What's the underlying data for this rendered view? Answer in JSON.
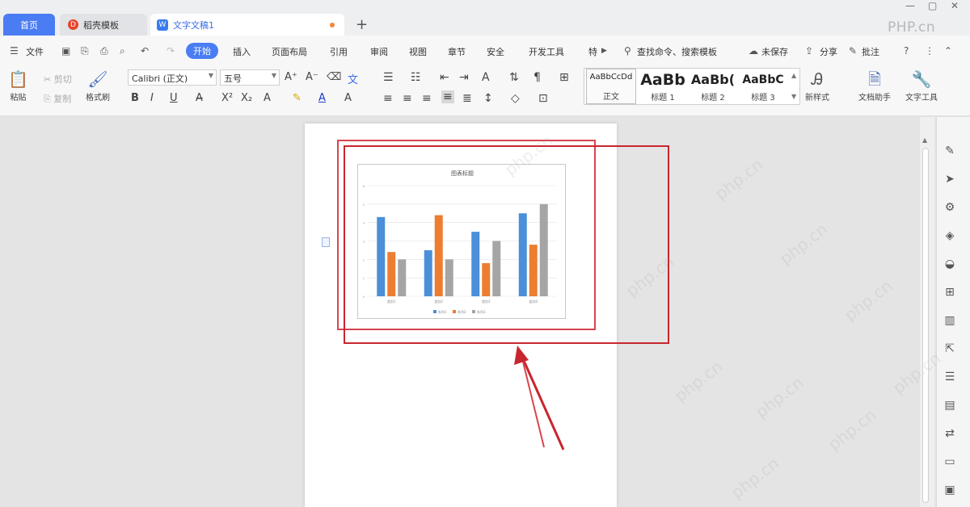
{
  "tabs": {
    "home": "首页",
    "template": "稻壳模板",
    "doc": "文字文稿1",
    "add": "+"
  },
  "brand": "PHP.cn",
  "menu": {
    "file": "文件",
    "items": [
      "开始",
      "插入",
      "页面布局",
      "引用",
      "审阅",
      "视图",
      "章节",
      "安全",
      "开发工具",
      "特"
    ],
    "search": "查找命令、搜索模板",
    "unsaved": "未保存",
    "share": "分享",
    "comment": "批注"
  },
  "ribbon": {
    "paste": "粘贴",
    "cut": "剪切",
    "copy": "复制",
    "format_painter": "格式刷",
    "font_name": "Calibri (正文)",
    "font_size": "五号",
    "styles": [
      {
        "sample": "AaBbCcDd",
        "label": "正文"
      },
      {
        "sample": "AaBb",
        "label": "标题 1"
      },
      {
        "sample": "AaBb(",
        "label": "标题 2"
      },
      {
        "sample": "AaBbC",
        "label": "标题 3"
      }
    ],
    "new_style": "新样式",
    "doc_assistant": "文档助手",
    "text_tools": "文字工具"
  },
  "chart_data": {
    "type": "bar",
    "title": "图表标题",
    "categories": [
      "类别1",
      "类别2",
      "类别3",
      "类别4"
    ],
    "series": [
      {
        "name": "系列1",
        "color": "#4a8fd8",
        "values": [
          4.3,
          2.5,
          3.5,
          4.5
        ]
      },
      {
        "name": "系列2",
        "color": "#ed7d31",
        "values": [
          2.4,
          4.4,
          1.8,
          2.8
        ]
      },
      {
        "name": "系列3",
        "color": "#a5a5a5",
        "values": [
          2.0,
          2.0,
          3.0,
          5.0
        ]
      }
    ],
    "ylim": [
      0,
      6
    ],
    "grid": true,
    "legend": "bottom"
  },
  "colors": {
    "accent": "#4a7cf4",
    "highlight": "#c8262e"
  }
}
